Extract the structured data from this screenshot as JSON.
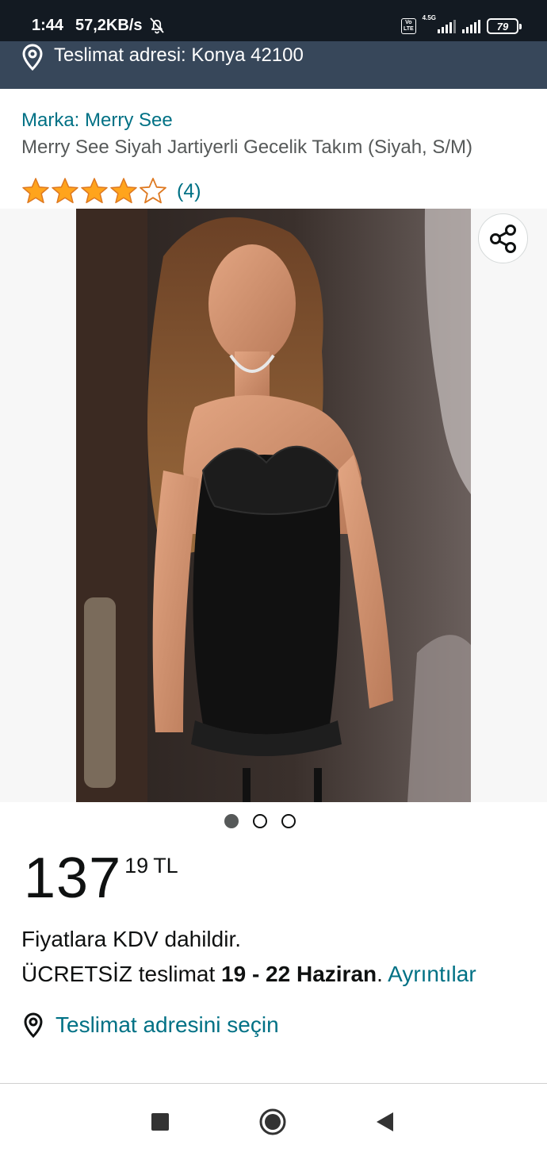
{
  "status_bar": {
    "time": "1:44",
    "speed": "57,2KB/s",
    "volte_label": "Vo LTE",
    "network_label": "4.5G",
    "battery_level": "79"
  },
  "address_bar": {
    "text": "Teslimat adresi: Konya 42100",
    "icon": "location-pin-icon"
  },
  "product": {
    "brand": "Marka: Merry See",
    "title": "Merry See Siyah Jartiyerli Gecelik Takım (Siyah, S/M)",
    "rating": 4.0,
    "rating_max": 5,
    "review_count": "(4)"
  },
  "gallery": {
    "image_alt": "product-photo",
    "image_count": 3,
    "active_index": 0,
    "share_icon": "share-icon"
  },
  "price": {
    "whole": "137",
    "fraction": "19",
    "currency": "TL"
  },
  "tax_note": "Fiyatlara KDV dahildir.",
  "delivery": {
    "prefix": "ÜCRETSİZ teslimat",
    "dates": "19 - 22 Haziran",
    "suffix": ".",
    "details_link": "Ayrıntılar"
  },
  "select_address": "Teslimat adresini seçin",
  "colors": {
    "link": "#007185",
    "header_bg": "#37475a",
    "status_bg": "#131a22",
    "star": "#ffa41c"
  }
}
